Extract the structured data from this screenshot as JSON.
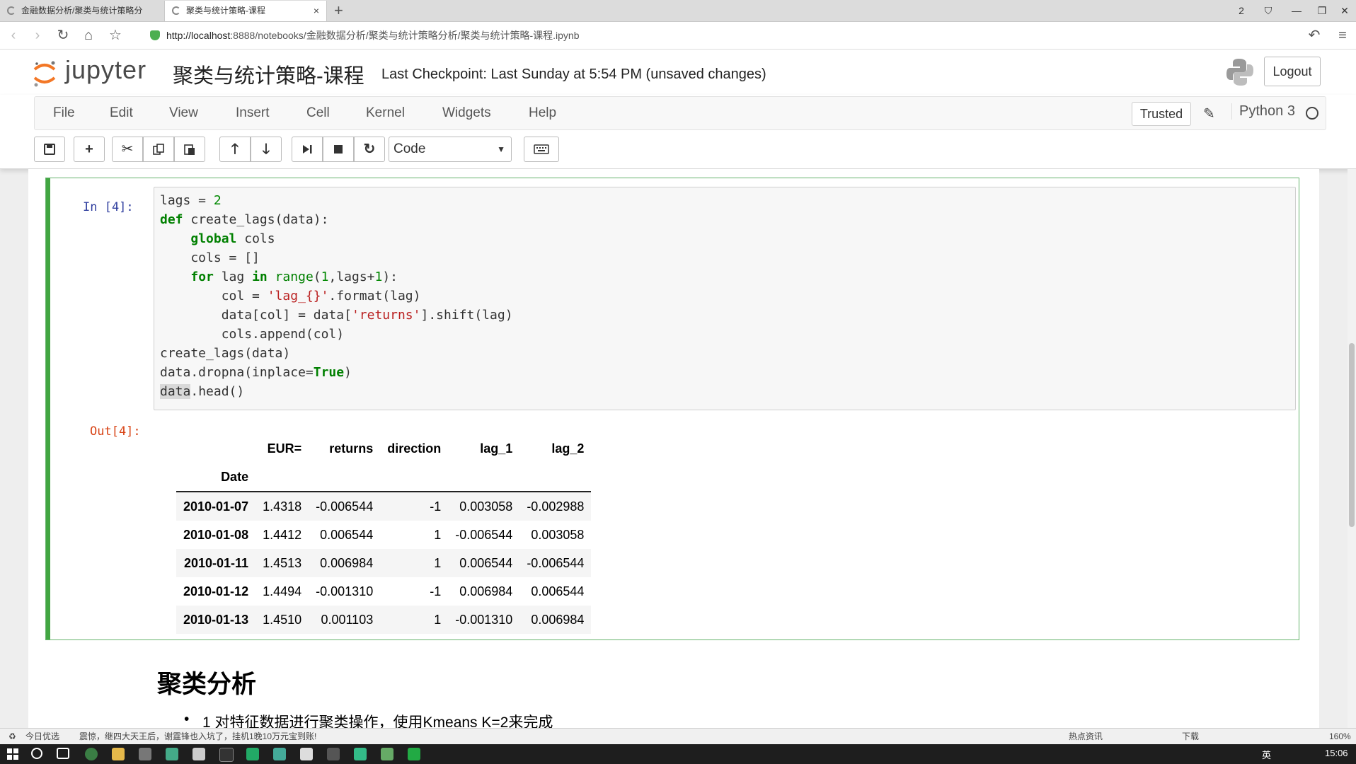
{
  "browser": {
    "tabs": [
      {
        "title": "金融数据分析/聚类与统计策略分"
      },
      {
        "title": "聚类与统计策略-课程",
        "close": "×"
      }
    ],
    "new_tab": "+",
    "window_controls": [
      "2",
      "⛉",
      "—",
      "❐",
      "✕"
    ],
    "url_host": "http://localhost",
    "url_rest": ":8888/notebooks/金融数据分析/聚类与统计策略分析/聚类与统计策略-课程.ipynb"
  },
  "header": {
    "logo_text": "jupyter",
    "notebook_name": "聚类与统计策略-课程",
    "checkpoint": "Last Checkpoint: Last Sunday at 5:54 PM (unsaved changes)",
    "logout": "Logout"
  },
  "menu": {
    "items": [
      "File",
      "Edit",
      "View",
      "Insert",
      "Cell",
      "Kernel",
      "Widgets",
      "Help"
    ],
    "trusted": "Trusted",
    "kernel": "Python 3"
  },
  "toolbar": {
    "cell_type": "Code"
  },
  "cell": {
    "in_prompt": "In  [4]:",
    "out_prompt": "Out[4]:"
  },
  "table": {
    "columns": [
      "EUR=",
      "returns",
      "direction",
      "lag_1",
      "lag_2"
    ],
    "index_name": "Date",
    "rows": [
      {
        "date": "2010-01-07",
        "values": [
          "1.4318",
          "-0.006544",
          "-1",
          "0.003058",
          "-0.002988"
        ]
      },
      {
        "date": "2010-01-08",
        "values": [
          "1.4412",
          "0.006544",
          "1",
          "-0.006544",
          "0.003058"
        ]
      },
      {
        "date": "2010-01-11",
        "values": [
          "1.4513",
          "0.006984",
          "1",
          "0.006544",
          "-0.006544"
        ]
      },
      {
        "date": "2010-01-12",
        "values": [
          "1.4494",
          "-0.001310",
          "-1",
          "0.006984",
          "0.006544"
        ]
      },
      {
        "date": "2010-01-13",
        "values": [
          "1.4510",
          "0.001103",
          "1",
          "-0.001310",
          "0.006984"
        ]
      }
    ]
  },
  "markdown": {
    "heading": "聚类分析",
    "bullet": "1 对特征数据进行聚类操作，使用Kmeans K=2来完成"
  },
  "statusbar": {
    "left": "今日优选",
    "news": "震惊，继四大天王后，谢霆锋也入坑了，挂机1晚10万元宝到账!",
    "hot": "热点资讯",
    "download": "下载",
    "zoom": "160%"
  },
  "taskbar": {
    "lang": "英",
    "time": "15:06"
  },
  "colors": {
    "cell_border": "#66b36c",
    "cell_bar": "#42a642",
    "in_prompt": "#303f9f",
    "out_prompt": "#d84315"
  }
}
